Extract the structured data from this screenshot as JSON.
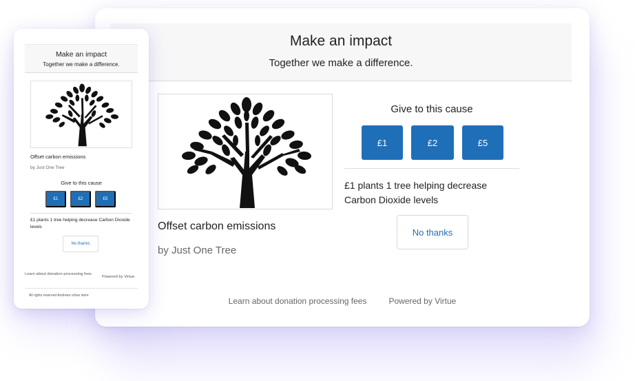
{
  "colors": {
    "accent": "#1f6fb8",
    "glow": "#bdb4f5"
  },
  "desktop": {
    "title": "Make an impact",
    "subtitle": "Together we make a difference.",
    "image_icon": "tree-icon",
    "cause_title": "Offset carbon emissions",
    "cause_by": "by Just One Tree",
    "give_label": "Give to this cause",
    "amounts": [
      "£1",
      "£2",
      "£5"
    ],
    "impact_text": "£1 plants 1 tree helping decrease Carbon Dioxide levels",
    "no_thanks": "No thanks",
    "footer_fees": "Learn about donation processing fees",
    "footer_powered": "Powered by Virtue"
  },
  "mobile": {
    "title": "Make an impact",
    "subtitle": "Together we make a difference.",
    "image_icon": "tree-icon",
    "cause_title": "Offset carbon emissions",
    "cause_by": "by Just One Tree",
    "give_label": "Give to this cause",
    "amounts": [
      "£1",
      "£2",
      "£5"
    ],
    "impact_text": "£1 plants 1 tree helping decrease Carbon Dioxide levels",
    "no_thanks": "No thanks",
    "footer_fees": "Learn about donation processing fees",
    "footer_powered": "Powered by Virtue",
    "rights": "All rights reserved Andrews virtue store"
  }
}
